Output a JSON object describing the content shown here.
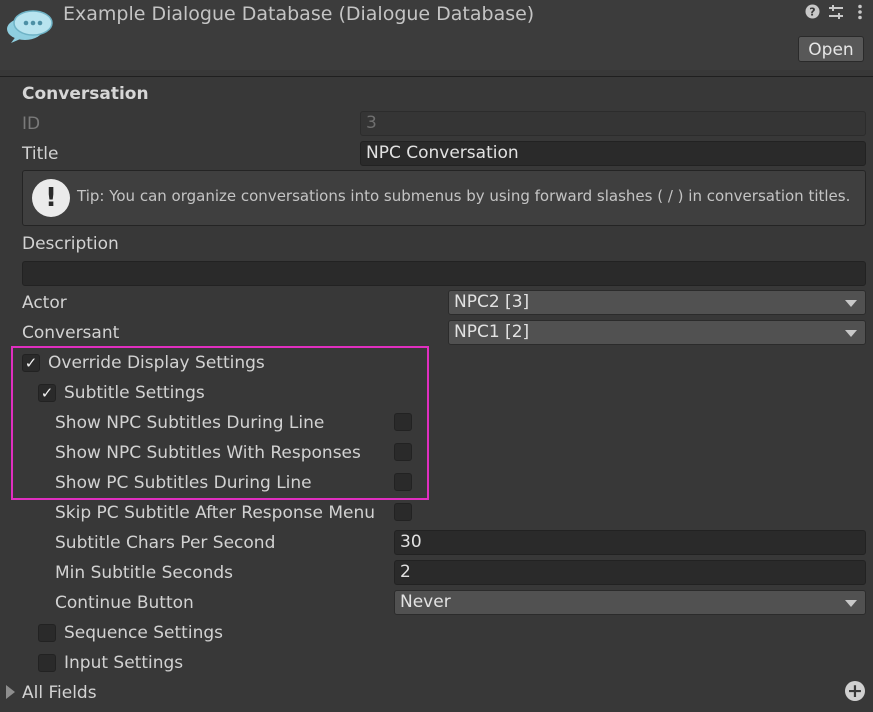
{
  "header": {
    "title": "Example Dialogue Database (Dialogue Database)",
    "open_label": "Open",
    "icons": [
      "logo-icon",
      "help-icon",
      "settings-sliders-icon",
      "kebab-menu-icon"
    ]
  },
  "conversation": {
    "section_label": "Conversation",
    "id_label": "ID",
    "id_value": "3",
    "title_label": "Title",
    "title_value": "NPC Conversation",
    "tip_text": "Tip: You can organize conversations into submenus by using forward slashes ( / ) in conversation titles.",
    "description_label": "Description",
    "description_value": "",
    "actor_label": "Actor",
    "actor_value": "NPC2 [3]",
    "conversant_label": "Conversant",
    "conversant_value": "NPC1 [2]"
  },
  "display": {
    "override_label": "Override Display Settings",
    "override_checked": true,
    "subtitle_label": "Subtitle Settings",
    "subtitle_checked": true,
    "show_npc_during_line": "Show NPC Subtitles During Line",
    "show_npc_with_responses": "Show NPC Subtitles With Responses",
    "show_pc_during_line": "Show PC Subtitles During Line",
    "skip_pc_after_response": "Skip PC Subtitle After Response Menu",
    "chars_per_second_label": "Subtitle Chars Per Second",
    "chars_per_second_value": "30",
    "min_seconds_label": "Min Subtitle Seconds",
    "min_seconds_value": "2",
    "continue_label": "Continue Button",
    "continue_value": "Never",
    "sequence_label": "Sequence Settings",
    "input_label": "Input Settings"
  },
  "footer": {
    "all_fields_label": "All Fields"
  },
  "colors": {
    "background": "#383838",
    "highlight": "#e02fc0"
  }
}
